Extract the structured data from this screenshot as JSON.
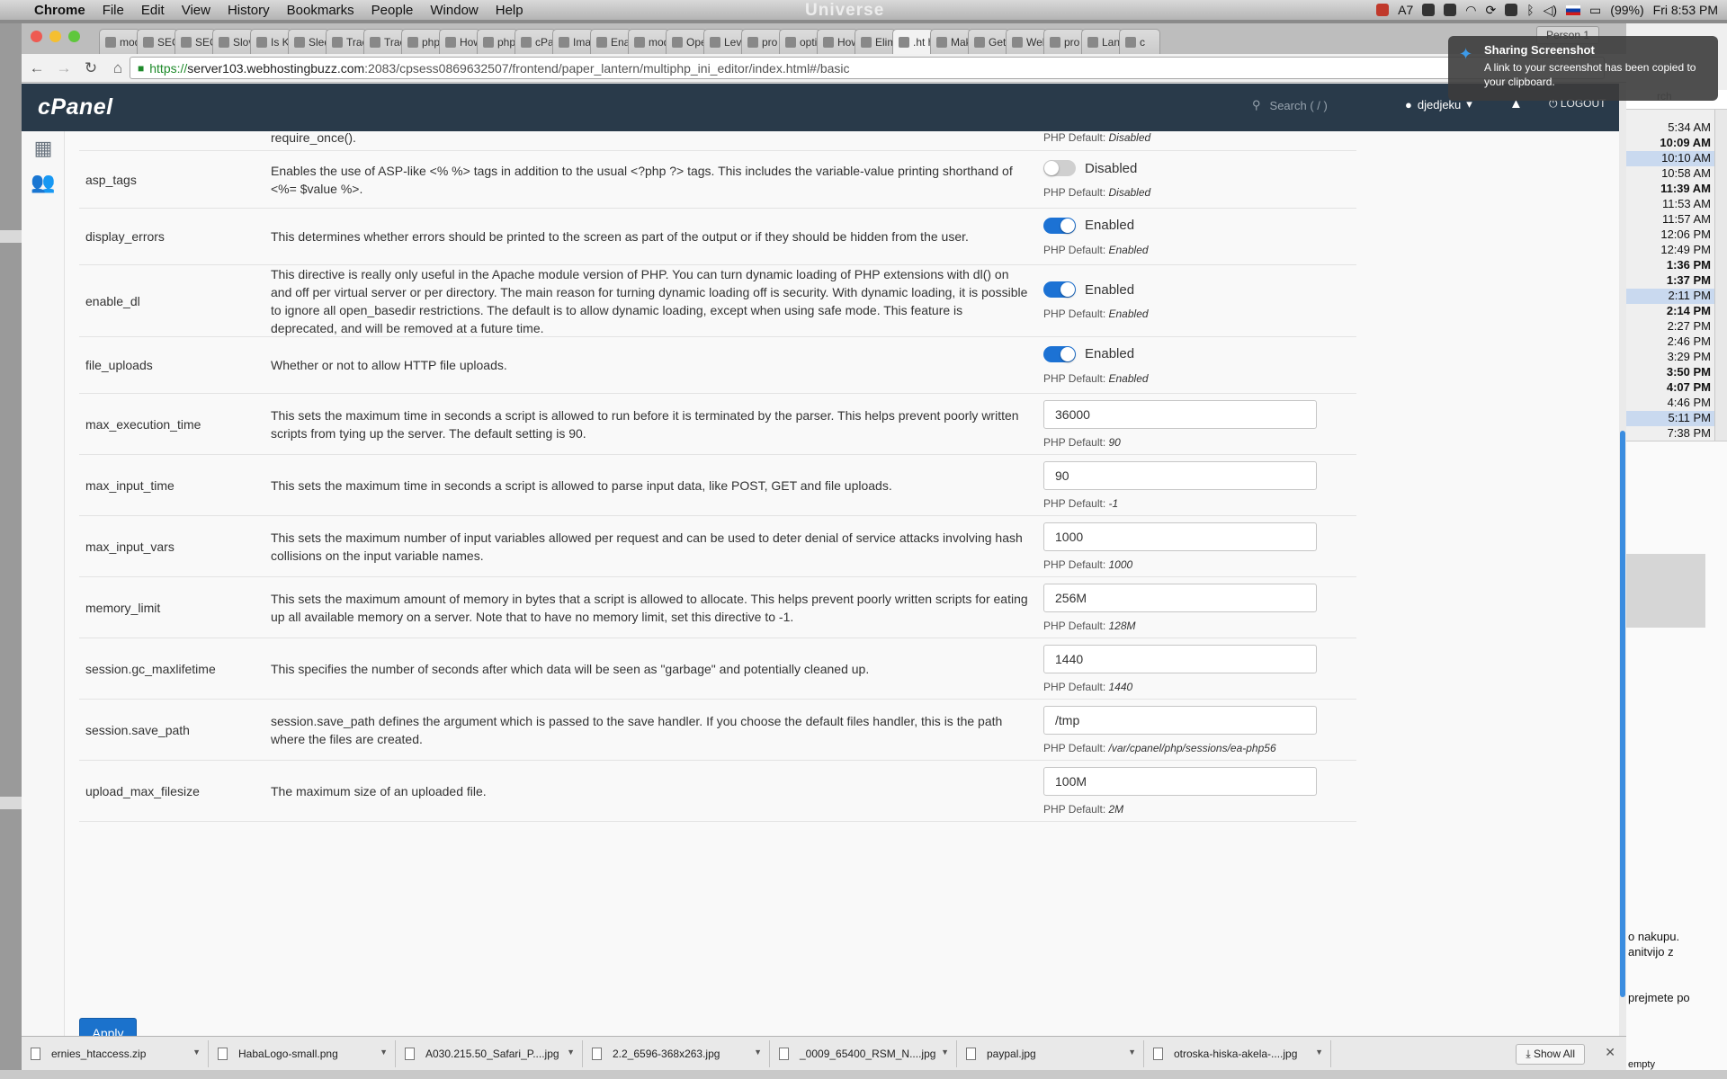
{
  "menubar": {
    "app": "Chrome",
    "items": [
      "File",
      "Edit",
      "View",
      "History",
      "Bookmarks",
      "People",
      "Window",
      "Help"
    ],
    "background_label": "Universe",
    "battery": "(99%)",
    "clock": "Fri 8:53 PM"
  },
  "browser": {
    "tabs": [
      "mod",
      "SEO",
      "SEO",
      "Slov",
      "Is K",
      "Sled",
      "Trac",
      "Trac",
      "php",
      "How",
      "php",
      "cPan",
      "Ima",
      "Enal",
      "mod",
      "Ope",
      "Leve",
      "pro",
      "opti",
      "How",
      "Elim",
      ".ht htac",
      "Mak",
      "Gett",
      "Web",
      "pro",
      "Lan",
      "c"
    ],
    "profile": "Person 1",
    "url_scheme": "https://",
    "url_host": "server103.webhostingbuzz.com",
    "url_rest": ":2083/cpsess0869632507/frontend/paper_lantern/multiphp_ini_editor/index.html#/basic"
  },
  "cpanel": {
    "logo": "cPanel",
    "search_placeholder": "Search ( / )",
    "user": "djedjeku",
    "logout": "LOGOUT"
  },
  "partial_top": {
    "desc": "require_once().",
    "default_label": "PHP Default:",
    "default_value": "Disabled"
  },
  "default_label": "PHP Default:",
  "rows": [
    {
      "name": "asp_tags",
      "desc": "Enables the use of ASP-like <% %> tags in addition to the usual <?php ?> tags. This includes the variable-value printing shorthand of <%= $value %>.",
      "type": "toggle",
      "on": false,
      "state": "Disabled",
      "default": "Disabled"
    },
    {
      "name": "display_errors",
      "desc": "This determines whether errors should be printed to the screen as part of the output or if they should be hidden from the user.",
      "type": "toggle",
      "on": true,
      "state": "Enabled",
      "default": "Enabled"
    },
    {
      "name": "enable_dl",
      "desc": "This directive is really only useful in the Apache module version of PHP. You can turn dynamic loading of PHP extensions with dl() on and off per virtual server or per directory. The main reason for turning dynamic loading off is security. With dynamic loading, it is possible to ignore all open_basedir restrictions. The default is to allow dynamic loading, except when using safe mode. This feature is deprecated, and will be removed at a future time.",
      "type": "toggle",
      "on": true,
      "state": "Enabled",
      "default": "Enabled"
    },
    {
      "name": "file_uploads",
      "desc": "Whether or not to allow HTTP file uploads.",
      "type": "toggle",
      "on": true,
      "state": "Enabled",
      "default": "Enabled"
    },
    {
      "name": "max_execution_time",
      "desc": "This sets the maximum time in seconds a script is allowed to run before it is terminated by the parser. This helps prevent poorly written scripts from tying up the server. The default setting is 90.",
      "type": "text",
      "value": "36000",
      "default": "90"
    },
    {
      "name": "max_input_time",
      "desc": "This sets the maximum time in seconds a script is allowed to parse input data, like POST, GET and file uploads.",
      "type": "text",
      "value": "90",
      "default": "-1"
    },
    {
      "name": "max_input_vars",
      "desc": "This sets the maximum number of input variables allowed per request and can be used to deter denial of service attacks involving hash collisions on the input variable names.",
      "type": "text",
      "value": "1000",
      "default": "1000"
    },
    {
      "name": "memory_limit",
      "desc": "This sets the maximum amount of memory in bytes that a script is allowed to allocate. This helps prevent poorly written scripts for eating up all available memory on a server. Note that to have no memory limit, set this directive to -1.",
      "type": "text",
      "value": "256M",
      "default": "128M"
    },
    {
      "name": "session.gc_maxlifetime",
      "desc": "This specifies the number of seconds after which data will be seen as \"garbage\" and potentially cleaned up.",
      "type": "text",
      "value": "1440",
      "default": "1440"
    },
    {
      "name": "session.save_path",
      "desc": "session.save_path defines the argument which is passed to the save handler. If you choose the default files handler, this is the path where the files are created.",
      "type": "text",
      "value": "/tmp",
      "default": "/var/cpanel/php/sessions/ea-php56"
    },
    {
      "name": "upload_max_filesize",
      "desc": "The maximum size of an uploaded file.",
      "type": "text",
      "value": "100M",
      "default": "2M"
    }
  ],
  "apply_label": "Apply",
  "downloads": [
    "ernies_htaccess.zip",
    "HabaLogo-small.png",
    "A030.215.50_Safari_P....jpg",
    "2.2_6596-368x263.jpg",
    "_0009_65400_RSM_N....jpg",
    "paypal.jpg",
    "otroska-hiska-akela-....jpg"
  ],
  "show_all": "Show All",
  "notification": {
    "title": "Sharing Screenshot",
    "body": "A link to your screenshot has been copied to your clipboard."
  },
  "side": {
    "search": "rch",
    "times": [
      "5:34 AM",
      "10:09 AM",
      "10:10 AM",
      "10:58 AM",
      "11:39 AM",
      "11:53 AM",
      "11:57 AM",
      "12:06 PM",
      "12:49 PM",
      "1:36 PM",
      "1:37 PM",
      "2:11 PM",
      "2:14 PM",
      "2:27 PM",
      "2:46 PM",
      "3:29 PM",
      "3:50 PM",
      "4:07 PM",
      "4:46 PM",
      "5:11 PM",
      "7:38 PM"
    ],
    "bold_times": [
      1,
      4,
      9,
      10,
      12,
      16,
      17
    ],
    "highlight_times": [
      2,
      11,
      19
    ],
    "msg1": "o nakupu.",
    "msg2": "anitvijo z",
    "msg3": "prejmete po",
    "msg4": "empty"
  }
}
